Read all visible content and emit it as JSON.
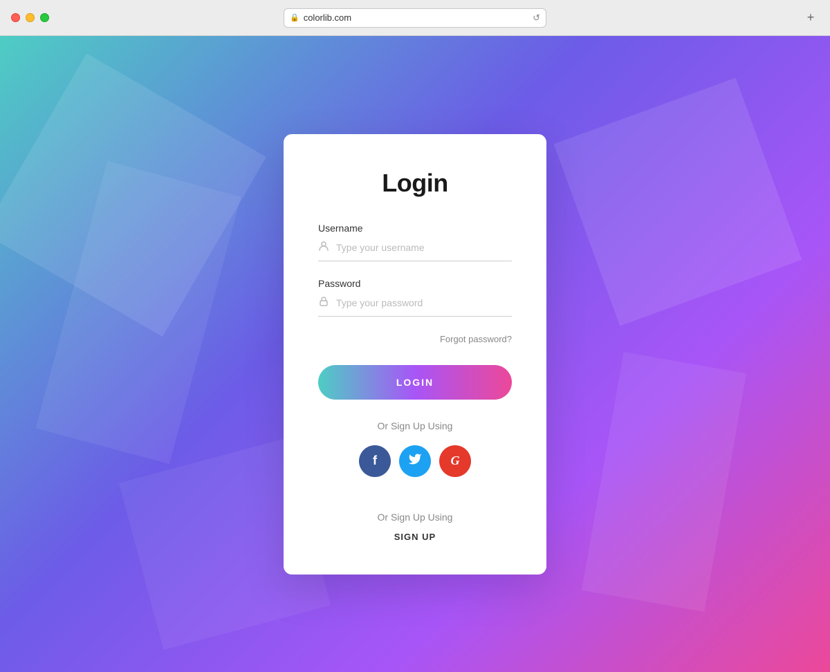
{
  "browser": {
    "url": "colorlib.com",
    "new_tab_icon": "+"
  },
  "page": {
    "title": "Login",
    "username_label": "Username",
    "username_placeholder": "Type your username",
    "password_label": "Password",
    "password_placeholder": "Type your password",
    "forgot_password_label": "Forgot password?",
    "login_button_label": "LOGIN",
    "social_divider": "Or Sign Up Using",
    "signup_divider": "Or Sign Up Using",
    "signup_label": "SIGN UP"
  },
  "social": {
    "facebook_letter": "f",
    "twitter_letter": "t",
    "google_letter": "G"
  }
}
